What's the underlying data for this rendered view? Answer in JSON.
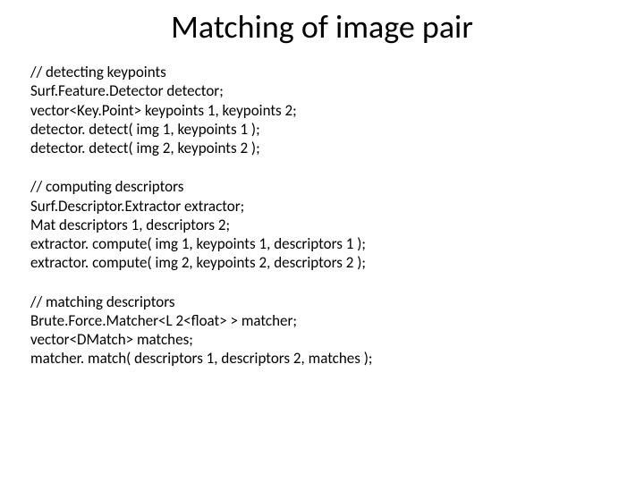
{
  "title": "Matching of image pair",
  "blocks": [
    {
      "lines": [
        "// detecting keypoints",
        "Surf.Feature.Detector detector;",
        "vector<Key.Point> keypoints 1, keypoints 2;",
        "detector. detect( img 1, keypoints 1 );",
        "detector. detect( img 2, keypoints 2 );"
      ]
    },
    {
      "lines": [
        "// computing descriptors",
        "Surf.Descriptor.Extractor extractor;",
        "Mat descriptors 1, descriptors 2;",
        "extractor. compute( img 1, keypoints 1, descriptors 1 );",
        "extractor. compute( img 2, keypoints 2, descriptors 2 );"
      ]
    },
    {
      "lines": [
        "// matching descriptors",
        "Brute.Force.Matcher<L 2<float> > matcher;",
        "vector<DMatch> matches;",
        "matcher. match( descriptors 1, descriptors 2, matches );"
      ]
    }
  ]
}
